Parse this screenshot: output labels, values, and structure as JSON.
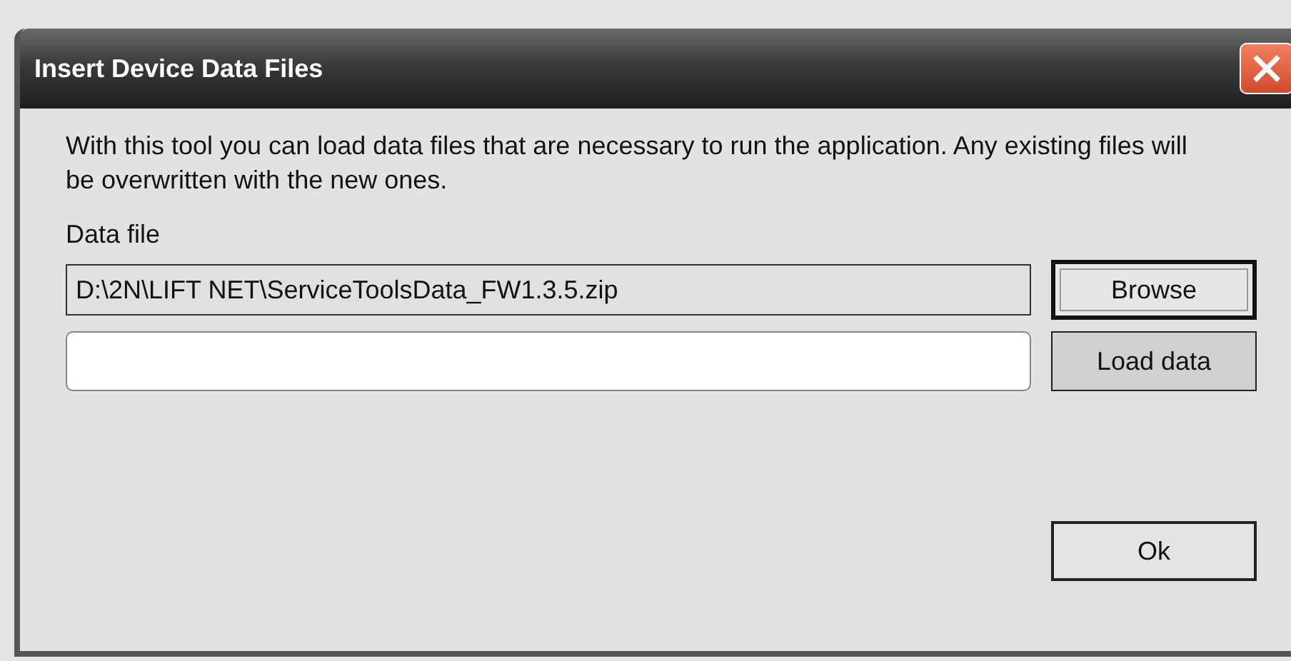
{
  "window": {
    "title": "Insert Device Data Files"
  },
  "description": "With this tool you can load data files that are necessary to run the application. Any existing files will be overwritten with the new ones.",
  "data_file": {
    "label": "Data file",
    "rows": [
      {
        "field": {
          "value": "D:\\2N\\LIFT NET\\ServiceToolsData_FW1.3.5.zip",
          "readonly": true
        },
        "button": {
          "label": "Browse",
          "default": true
        }
      },
      {
        "field": {
          "readonly": false
        },
        "button": {
          "label": "Load data",
          "default": false
        }
      }
    ]
  },
  "ok_button": {
    "label": "Ok",
    "default": false
  }
}
